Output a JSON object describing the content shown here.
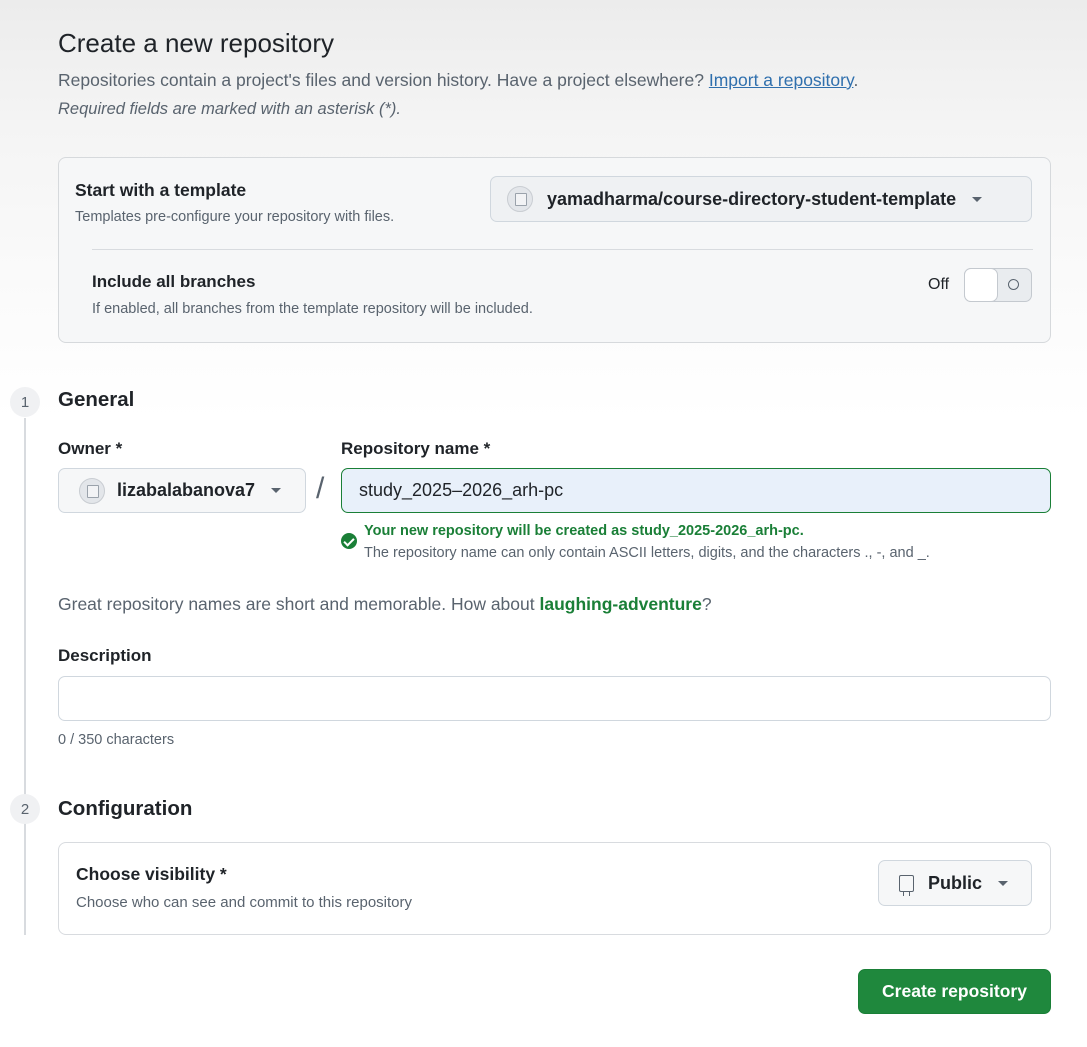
{
  "header": {
    "title": "Create a new repository",
    "subtitle": "Repositories contain a project's files and version history. Have a project elsewhere? ",
    "import_link": "Import a repository",
    "subtitle_end": ".",
    "required_note": "Required fields are marked with an asterisk (*)."
  },
  "template": {
    "label": "Start with a template",
    "description": "Templates pre-configure your repository with files.",
    "selected": "yamadharma/course-directory-student-template",
    "include_branches_label": "Include all branches",
    "include_branches_desc": "If enabled, all branches from the template repository will be included.",
    "toggle_state": "Off"
  },
  "general": {
    "step": "1",
    "title": "General",
    "owner_label": "Owner *",
    "owner_value": "lizabalabanova7",
    "separator": "/",
    "repo_label": "Repository name *",
    "repo_value": "study_2025–2026_arh-pc",
    "valid_msg": "Your new repository will be created as study_2025-2026_arh-pc.",
    "rules_msg": "The repository name can only contain ASCII letters, digits, and the characters ., -, and _.",
    "suggest_prefix": "Great repository names are short and memorable. How about ",
    "suggest_name": "laughing-adventure",
    "suggest_suffix": "?",
    "description_label": "Description",
    "description_value": "",
    "char_count": "0 / 350 characters"
  },
  "configuration": {
    "step": "2",
    "title": "Configuration",
    "visibility_label": "Choose visibility *",
    "visibility_desc": "Choose who can see and commit to this repository",
    "visibility_value": "Public"
  },
  "actions": {
    "create_label": "Create repository"
  },
  "colors": {
    "accent_green": "#1f883d",
    "success_text": "#1a7f37",
    "link": "#0969da",
    "muted_text": "#59636e"
  },
  "icons": {
    "avatar": "broken-image-avatar-icon",
    "caret": "caret-down-icon",
    "check": "check-circle-icon",
    "repo": "repo-icon"
  }
}
